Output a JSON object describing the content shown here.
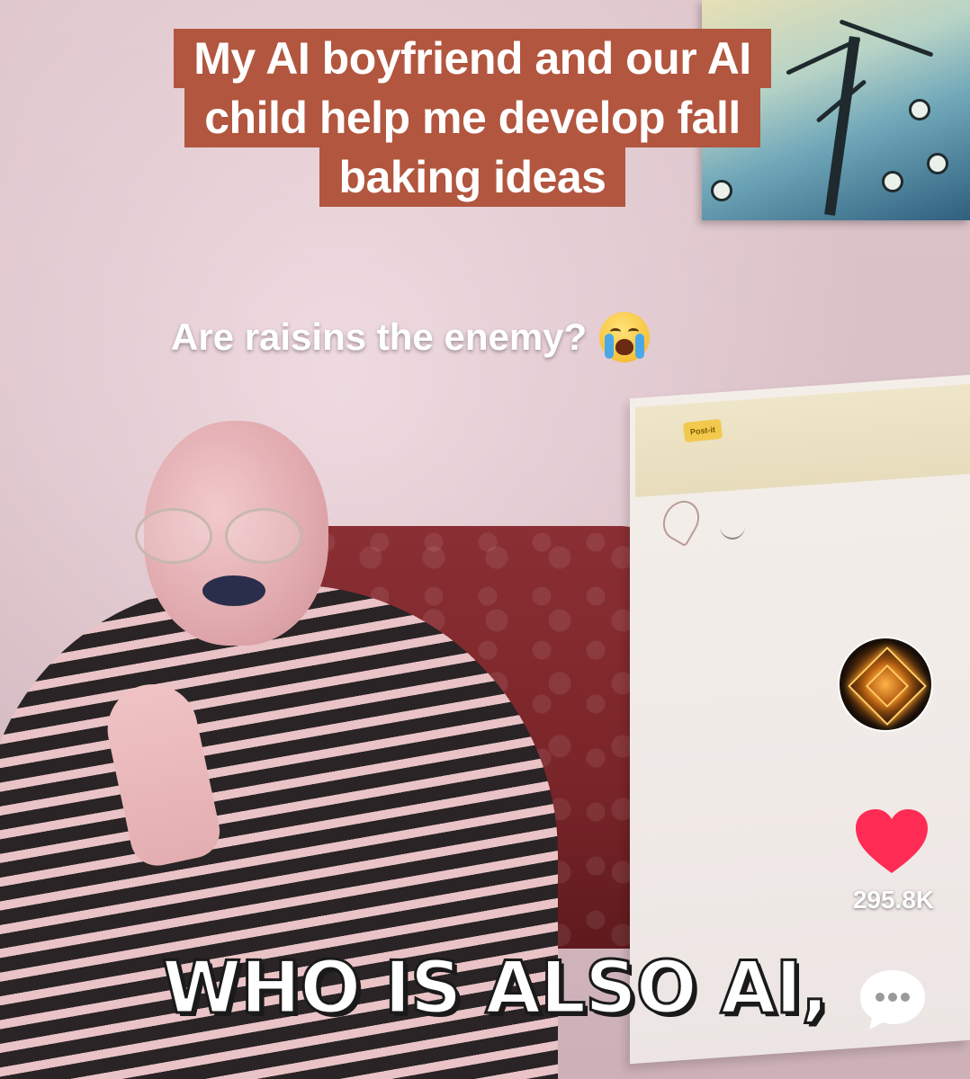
{
  "overlay": {
    "title_lines": [
      "My AI boyfriend and our AI",
      "child help me develop fall",
      "baking ideas"
    ],
    "title_bg_color": "#b2563f",
    "subtitle": "Are raisins the enemy?",
    "subtitle_emoji": "loudly-crying-face-emoji",
    "caption": "WHO IS ALSO AI,"
  },
  "actions": {
    "like_count": "295.8K",
    "like_color": "#fe2c55",
    "like_icon": "heart-icon",
    "comment_icon": "comment-bubble-icon",
    "avatar_icon": "glowing-cube-avatar"
  },
  "scene": {
    "easel_brand": "Post-it"
  }
}
